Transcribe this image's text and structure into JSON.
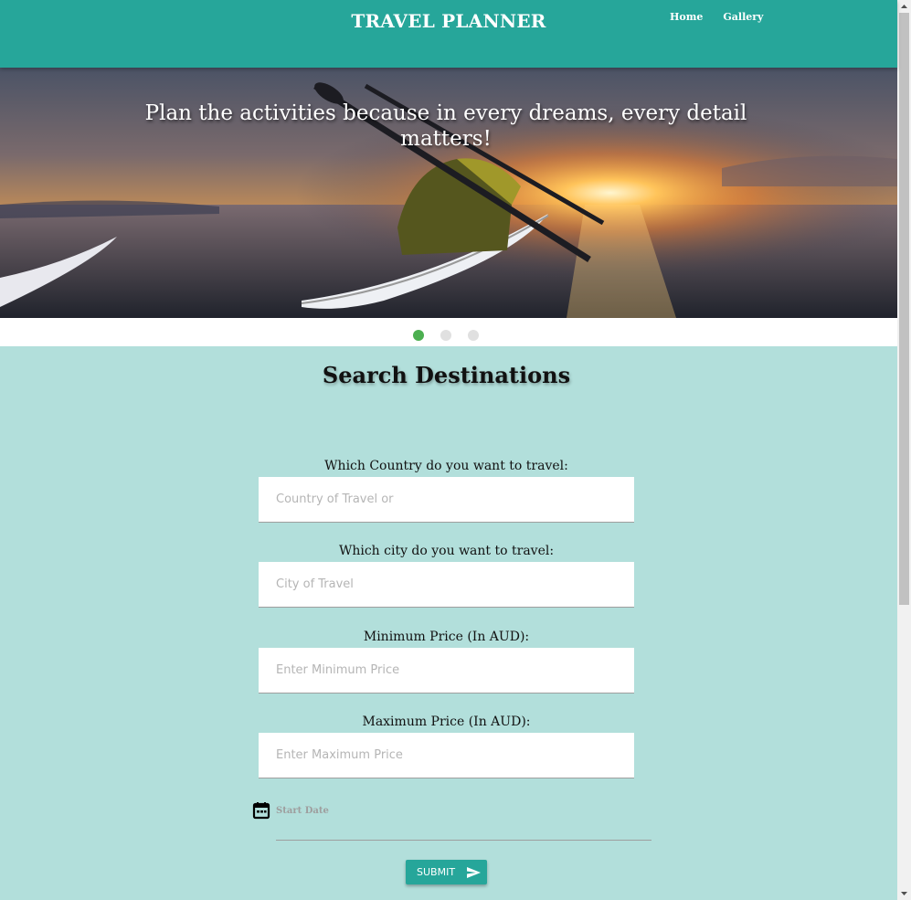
{
  "nav": {
    "brand": "TRAVEL PLANNER",
    "links": [
      "Home",
      "Gallery"
    ],
    "bg_color": "#26a69a"
  },
  "hero": {
    "caption": "Plan the activities because in every dreams, every detail matters!",
    "slide_count": 3,
    "active_slide": 1
  },
  "search": {
    "title": "Search Destinations",
    "fields": [
      {
        "label": "Which Country do you want to travel:",
        "placeholder": "Country of Travel or"
      },
      {
        "label": "Which city do you want to travel:",
        "placeholder": "City of Travel"
      },
      {
        "label": "Minimum Price (In AUD):",
        "placeholder": "Enter Minimum Price"
      },
      {
        "label": "Maximum Price (In AUD):",
        "placeholder": "Enter Maximum Price"
      }
    ],
    "date_label": "Start Date",
    "date_icon": "calendar-icon",
    "submit_label": "SUBMIT",
    "submit_icon": "send-icon"
  },
  "colors": {
    "primary": "#26a69a",
    "page_bg": "#b2dfdb",
    "indicator_active": "#4caf50",
    "indicator_inactive": "#e0e0e0"
  }
}
